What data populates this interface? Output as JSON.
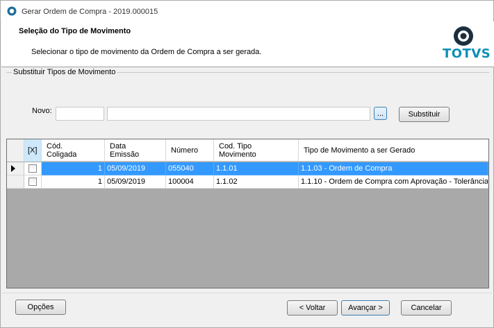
{
  "window": {
    "title": "Gerar Ordem de Compra - 2019.000015"
  },
  "header": {
    "title": "Seleção do Tipo de Movimento",
    "subtitle": "Selecionar o tipo de movimento da Ordem de Compra a ser gerada.",
    "logo_text": "TOTVS"
  },
  "substituir": {
    "group_label": "Substituir Tipos de Movimento",
    "novo_label": "Novo:",
    "code_value": "",
    "description_value": "",
    "lookup_label": "...",
    "substituir_label": "Substituir"
  },
  "grid": {
    "columns": {
      "select_all": "[X]",
      "cod_coligada_1": "Cód.",
      "cod_coligada_2": "Coligada",
      "data_emissao_1": "Data",
      "data_emissao_2": "Emissão",
      "numero": "Número",
      "cod_tipo_mov_1": "Cod. Tipo",
      "cod_tipo_mov_2": "Movimento",
      "tipo_gerado": "Tipo de Movimento a ser Gerado"
    },
    "rows": [
      {
        "cod_coligada": "1",
        "data_emissao": "05/09/2019",
        "numero": "055040",
        "cod_tipo_mov": "1.1.01",
        "tipo_gerado": "1.1.03 - Ordem de Compra",
        "selected": true
      },
      {
        "cod_coligada": "1",
        "data_emissao": "05/09/2019",
        "numero": "100004",
        "cod_tipo_mov": "1.1.02",
        "tipo_gerado": "1.1.10 - Ordem de Compra com Aprovação - Tolerância",
        "selected": false
      }
    ]
  },
  "footer": {
    "opcoes_label": "Opções",
    "voltar_label": "< Voltar",
    "avancar_label": "Avançar >",
    "cancelar_label": "Cancelar"
  },
  "colors": {
    "accent": "#0e8fb5",
    "selection": "#3399ff"
  }
}
